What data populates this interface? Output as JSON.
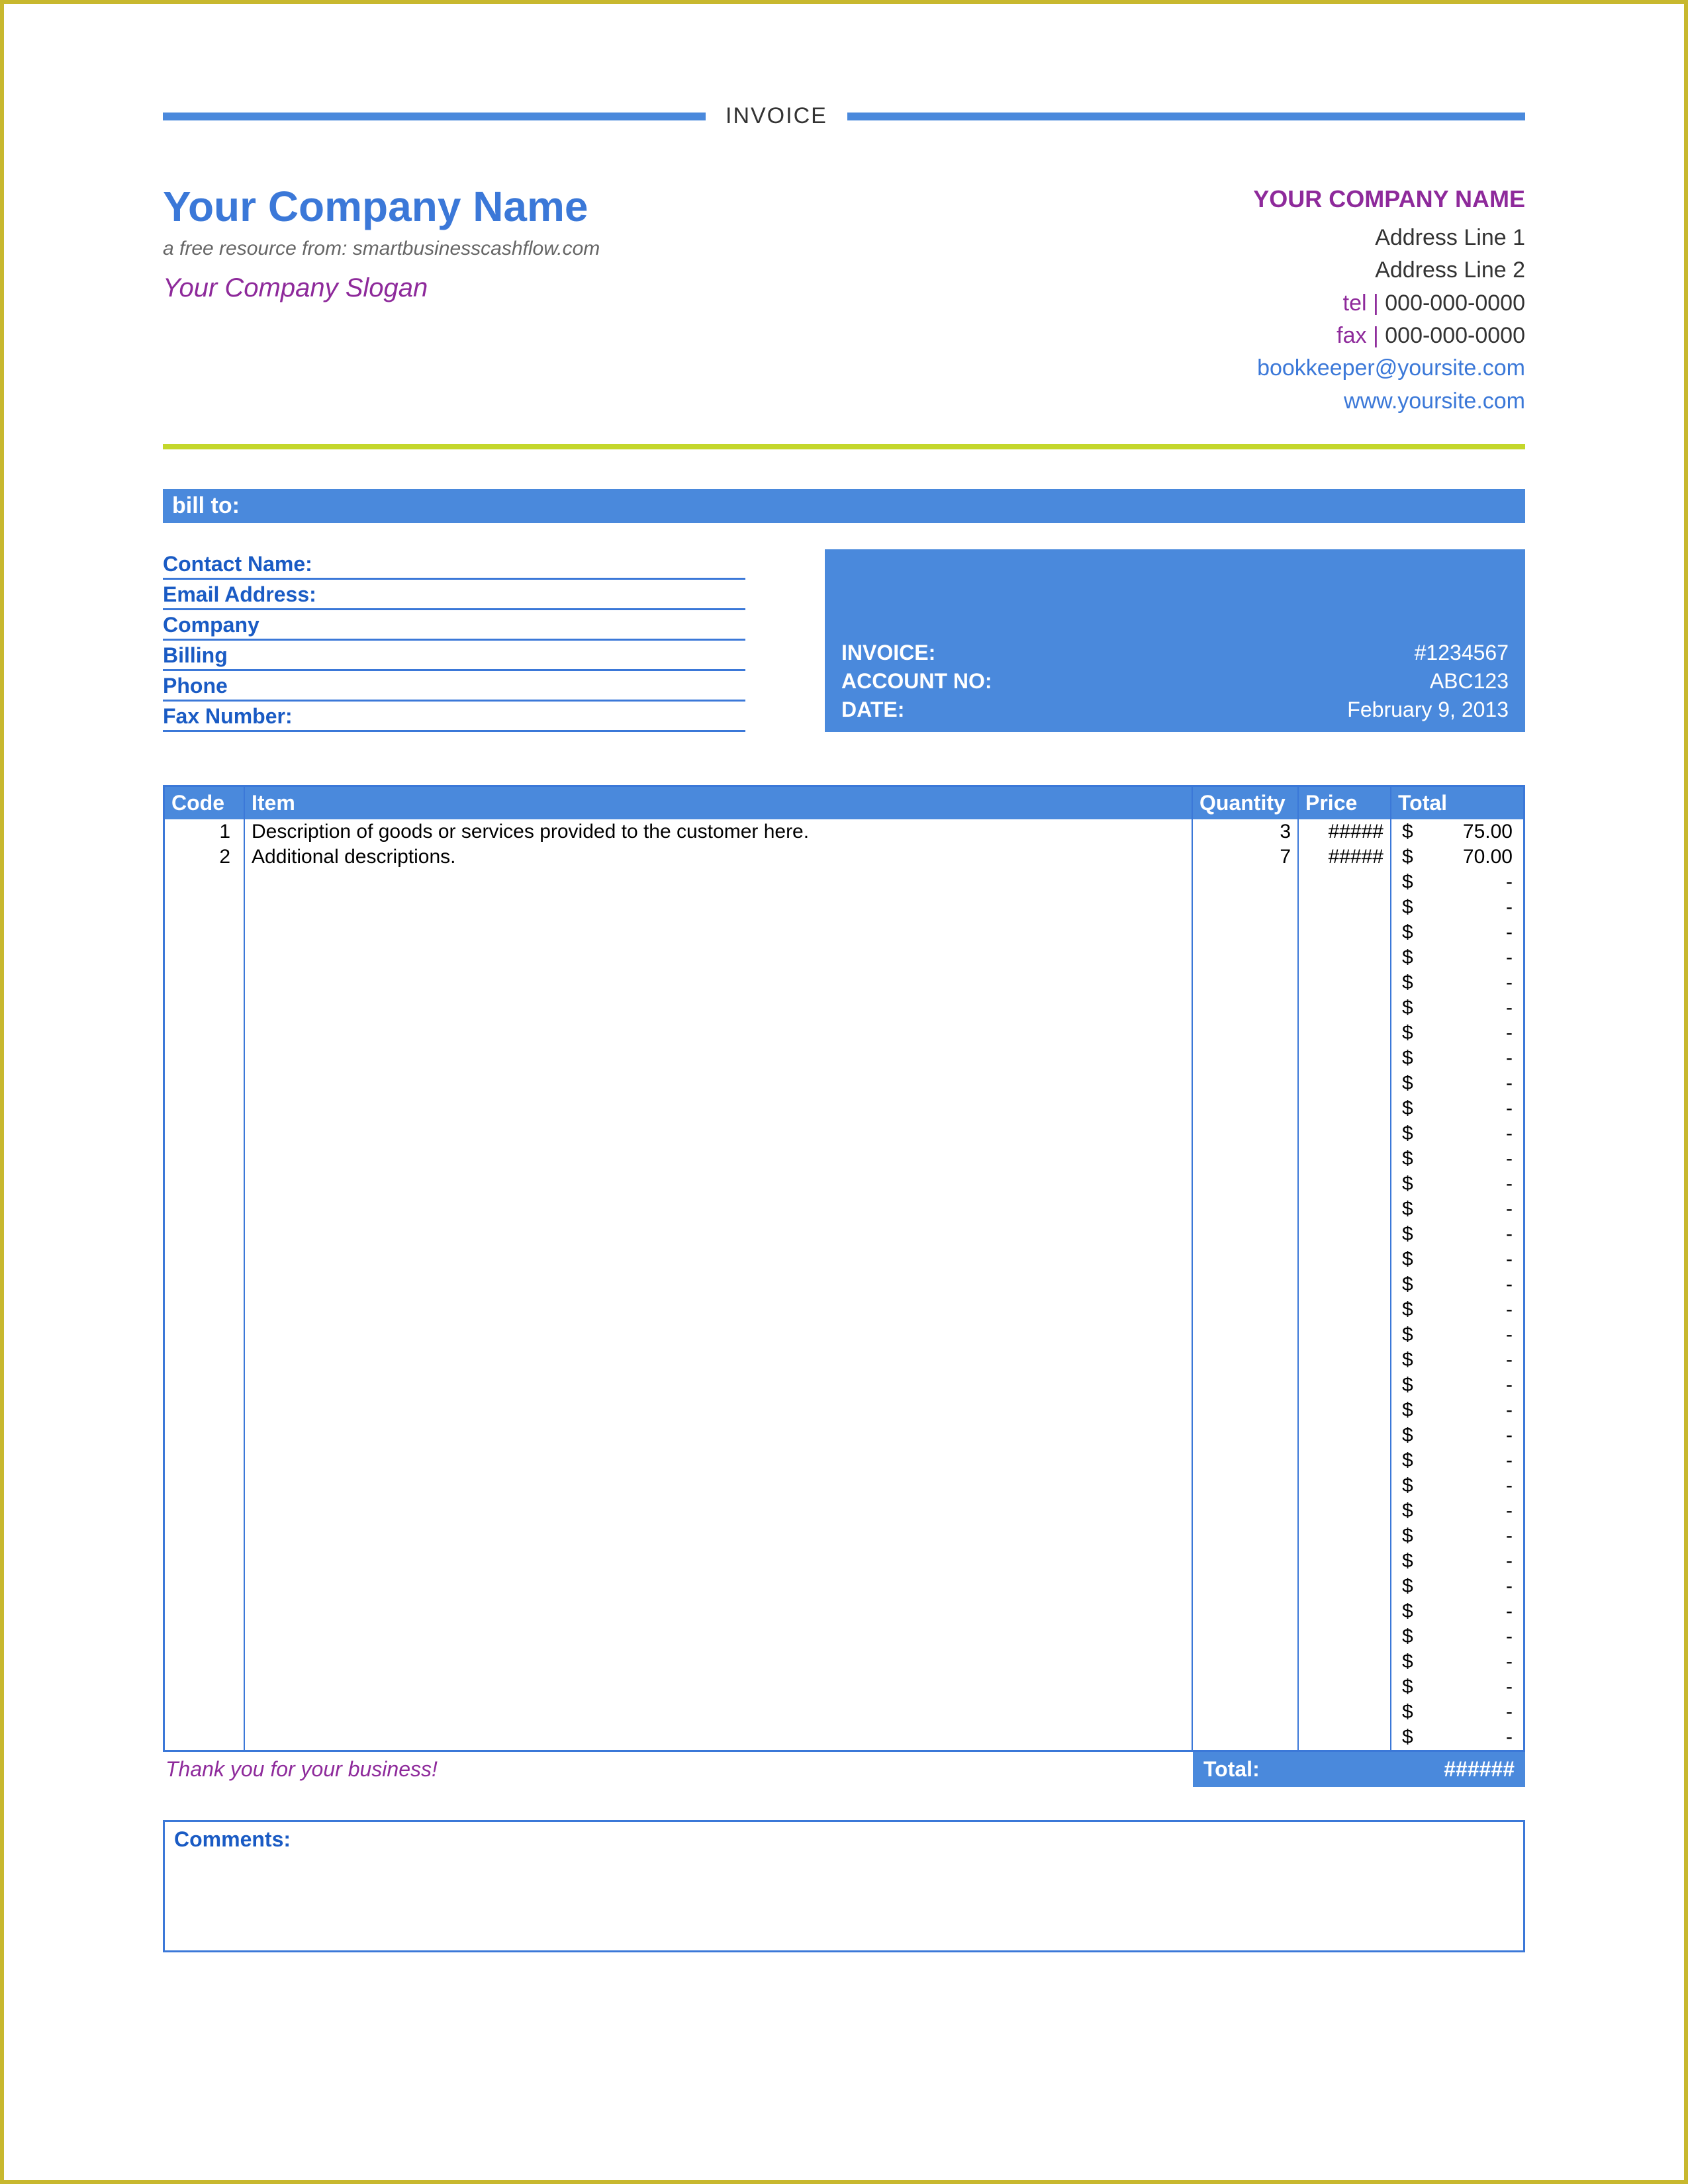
{
  "title": "INVOICE",
  "company_left": {
    "name": "Your Company Name",
    "resource": "a free resource from: smartbusinesscashflow.com",
    "slogan": "Your Company Slogan"
  },
  "company_right": {
    "name": "YOUR COMPANY NAME",
    "addr1": "Address Line 1",
    "addr2": "Address Line 2",
    "tel_label": "tel |",
    "tel": " 000-000-0000",
    "fax_label": "fax |",
    "fax": " 000-000-0000",
    "email": "bookkeeper@yoursite.com",
    "web": "www.yoursite.com"
  },
  "billto_label": "bill to:",
  "contact_fields": [
    "Contact Name:",
    "Email Address:",
    "Company",
    "Billing",
    "Phone",
    "Fax Number:"
  ],
  "inv_box": {
    "invoice_l": "INVOICE:",
    "invoice_r": "#1234567",
    "account_l": "ACCOUNT NO:",
    "account_r": "ABC123",
    "date_l": "DATE:",
    "date_r": "February 9, 2013"
  },
  "columns": {
    "code": "Code",
    "item": "Item",
    "qty": "Quantity",
    "price": "Price",
    "total": "Total"
  },
  "rows": [
    {
      "code": "1",
      "item": "Description of goods or services provided to the customer here.",
      "qty": "3",
      "price": "#####",
      "total": "75.00"
    },
    {
      "code": "2",
      "item": "Additional descriptions.",
      "qty": "7",
      "price": "#####",
      "total": "70.00"
    },
    {
      "code": "",
      "item": "",
      "qty": "",
      "price": "",
      "total": "-"
    },
    {
      "code": "",
      "item": "",
      "qty": "",
      "price": "",
      "total": "-"
    },
    {
      "code": "",
      "item": "",
      "qty": "",
      "price": "",
      "total": "-"
    },
    {
      "code": "",
      "item": "",
      "qty": "",
      "price": "",
      "total": "-"
    },
    {
      "code": "",
      "item": "",
      "qty": "",
      "price": "",
      "total": "-"
    },
    {
      "code": "",
      "item": "",
      "qty": "",
      "price": "",
      "total": "-"
    },
    {
      "code": "",
      "item": "",
      "qty": "",
      "price": "",
      "total": "-"
    },
    {
      "code": "",
      "item": "",
      "qty": "",
      "price": "",
      "total": "-"
    },
    {
      "code": "",
      "item": "",
      "qty": "",
      "price": "",
      "total": "-"
    },
    {
      "code": "",
      "item": "",
      "qty": "",
      "price": "",
      "total": "-"
    },
    {
      "code": "",
      "item": "",
      "qty": "",
      "price": "",
      "total": "-"
    },
    {
      "code": "",
      "item": "",
      "qty": "",
      "price": "",
      "total": "-"
    },
    {
      "code": "",
      "item": "",
      "qty": "",
      "price": "",
      "total": "-"
    },
    {
      "code": "",
      "item": "",
      "qty": "",
      "price": "",
      "total": "-"
    },
    {
      "code": "",
      "item": "",
      "qty": "",
      "price": "",
      "total": "-"
    },
    {
      "code": "",
      "item": "",
      "qty": "",
      "price": "",
      "total": "-"
    },
    {
      "code": "",
      "item": "",
      "qty": "",
      "price": "",
      "total": "-"
    },
    {
      "code": "",
      "item": "",
      "qty": "",
      "price": "",
      "total": "-"
    },
    {
      "code": "",
      "item": "",
      "qty": "",
      "price": "",
      "total": "-"
    },
    {
      "code": "",
      "item": "",
      "qty": "",
      "price": "",
      "total": "-"
    },
    {
      "code": "",
      "item": "",
      "qty": "",
      "price": "",
      "total": "-"
    },
    {
      "code": "",
      "item": "",
      "qty": "",
      "price": "",
      "total": "-"
    },
    {
      "code": "",
      "item": "",
      "qty": "",
      "price": "",
      "total": "-"
    },
    {
      "code": "",
      "item": "",
      "qty": "",
      "price": "",
      "total": "-"
    },
    {
      "code": "",
      "item": "",
      "qty": "",
      "price": "",
      "total": "-"
    },
    {
      "code": "",
      "item": "",
      "qty": "",
      "price": "",
      "total": "-"
    },
    {
      "code": "",
      "item": "",
      "qty": "",
      "price": "",
      "total": "-"
    },
    {
      "code": "",
      "item": "",
      "qty": "",
      "price": "",
      "total": "-"
    },
    {
      "code": "",
      "item": "",
      "qty": "",
      "price": "",
      "total": "-"
    },
    {
      "code": "",
      "item": "",
      "qty": "",
      "price": "",
      "total": "-"
    },
    {
      "code": "",
      "item": "",
      "qty": "",
      "price": "",
      "total": "-"
    },
    {
      "code": "",
      "item": "",
      "qty": "",
      "price": "",
      "total": "-"
    },
    {
      "code": "",
      "item": "",
      "qty": "",
      "price": "",
      "total": "-"
    },
    {
      "code": "",
      "item": "",
      "qty": "",
      "price": "",
      "total": "-"
    },
    {
      "code": "",
      "item": "",
      "qty": "",
      "price": "",
      "total": "-"
    }
  ],
  "currency": "$",
  "thanks": "Thank you for your business!",
  "total_label": "Total:",
  "total_value": "######",
  "comments_label": "Comments:"
}
